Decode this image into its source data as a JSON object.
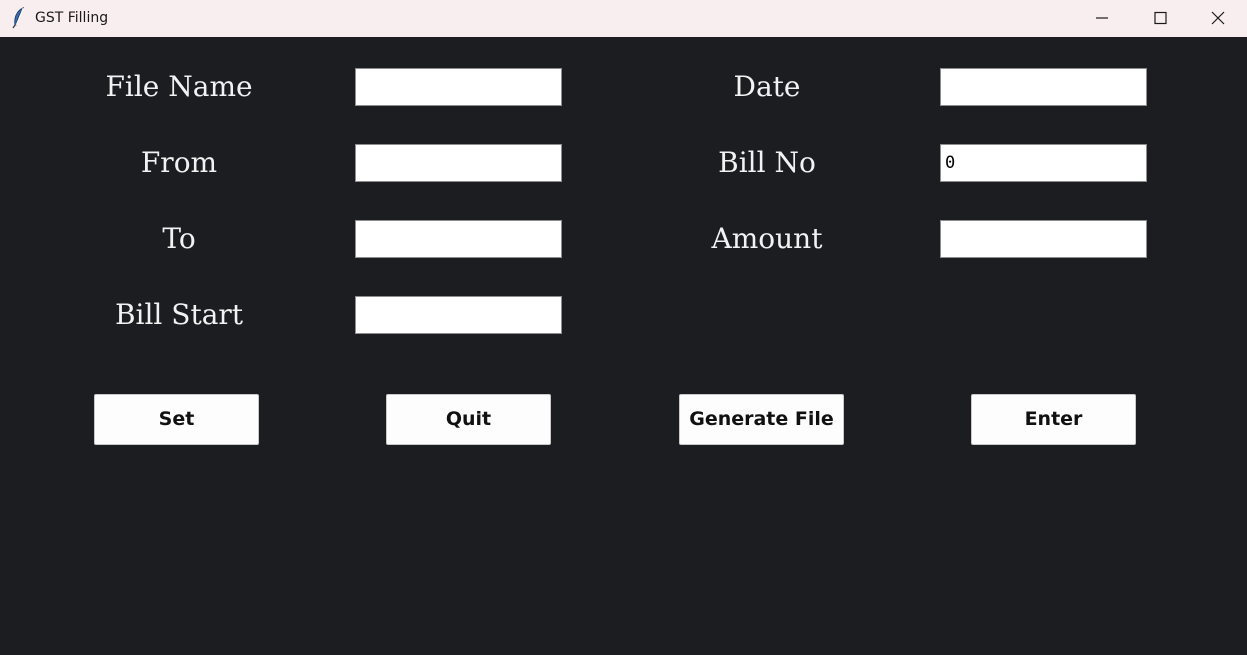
{
  "window": {
    "title": "GST Filling",
    "app_icon": "feather-icon",
    "controls": [
      "minimize-icon",
      "maximize-icon",
      "close-icon"
    ]
  },
  "colors": {
    "background": "#1b1d20",
    "titlebar": "#f9eeef",
    "label_text": "#f2f2f2",
    "input_bg": "#ffffff",
    "button_bg": "#fdfdfd"
  },
  "form": {
    "left": {
      "file_name": {
        "label": "File Name",
        "value": ""
      },
      "from": {
        "label": "From",
        "value": ""
      },
      "to": {
        "label": "To",
        "value": ""
      },
      "bill_start": {
        "label": "Bill Start",
        "value": ""
      }
    },
    "right": {
      "date": {
        "label": "Date",
        "value": ""
      },
      "bill_no": {
        "label": "Bill No",
        "value": "0"
      },
      "amount": {
        "label": "Amount",
        "value": ""
      }
    }
  },
  "buttons": {
    "set": "Set",
    "quit": "Quit",
    "generate_file": "Generate File",
    "enter": "Enter"
  }
}
